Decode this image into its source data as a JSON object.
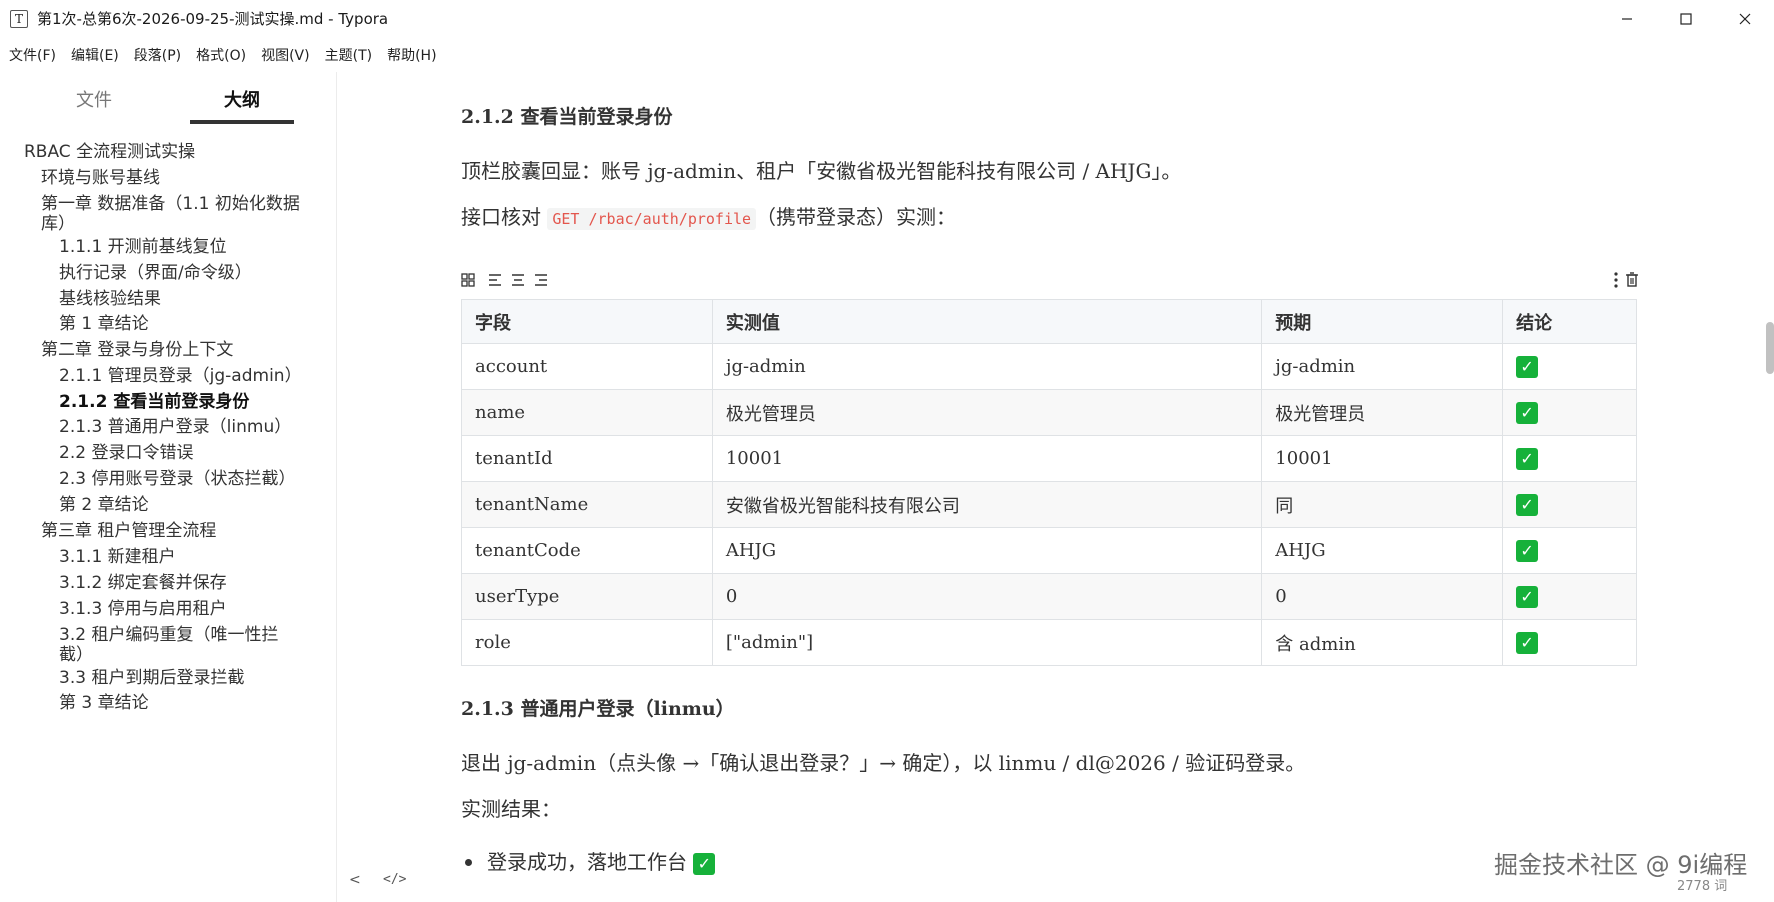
{
  "window": {
    "icon_glyph": "T",
    "title": "第1次-总第6次-2026-09-25-测试实操.md - Typora",
    "minimize_icon": "minimize-icon",
    "maximize_icon": "maximize-icon",
    "close_icon": "close-icon"
  },
  "menu": [
    "文件(F)",
    "编辑(E)",
    "段落(P)",
    "格式(O)",
    "视图(V)",
    "主题(T)",
    "帮助(H)"
  ],
  "sidebar": {
    "tabs": [
      "文件",
      "大纲"
    ],
    "active_tab": "大纲",
    "outline": [
      {
        "label": "RBAC 全流程测试实操",
        "level": 1
      },
      {
        "label": "环境与账号基线",
        "level": 2
      },
      {
        "label": "第一章 数据准备（1.1 初始化数据库）",
        "level": 2
      },
      {
        "label": "1.1.1 开测前基线复位",
        "level": 3
      },
      {
        "label": "执行记录（界面/命令级）",
        "level": 3
      },
      {
        "label": "基线核验结果",
        "level": 3
      },
      {
        "label": "第 1 章结论",
        "level": 3
      },
      {
        "label": "第二章 登录与身份上下文",
        "level": 2
      },
      {
        "label": "2.1.1 管理员登录（jg-admin）",
        "level": 3
      },
      {
        "label": "2.1.2 查看当前登录身份",
        "level": 3,
        "active": true
      },
      {
        "label": "2.1.3 普通用户登录（linmu）",
        "level": 3
      },
      {
        "label": "2.2 登录口令错误",
        "level": 3
      },
      {
        "label": "2.3 停用账号登录（状态拦截）",
        "level": 3
      },
      {
        "label": "第 2 章结论",
        "level": 3
      },
      {
        "label": "第三章 租户管理全流程",
        "level": 2
      },
      {
        "label": "3.1.1 新建租户",
        "level": 3
      },
      {
        "label": "3.1.2 绑定套餐并保存",
        "level": 3
      },
      {
        "label": "3.1.3 停用与启用租户",
        "level": 3
      },
      {
        "label": "3.2 租户编码重复（唯一性拦截）",
        "level": 3
      },
      {
        "label": "3.3 租户到期后登录拦截",
        "level": 3
      },
      {
        "label": "第 3 章结论",
        "level": 3
      }
    ],
    "footer": {
      "back_icon": "<",
      "source_icon": "</>"
    }
  },
  "doc": {
    "h_212": "2.1.2 查看当前登录身份",
    "p1": "顶栏胶囊回显：账号 jg-admin、租户「安徽省极光智能科技有限公司 / AHJG」。",
    "p2_prefix": "接口核对 ",
    "p2_code": "GET /rbac/auth/profile",
    "p2_suffix": "（携带登录态）实测：",
    "table_tools": {
      "grid_icon": "table-grid-icon",
      "align_left_icon": "align-left-icon",
      "align_center_icon": "align-center-icon",
      "align_right_icon": "align-right-icon",
      "more_icon": "more-vertical-icon",
      "delete_icon": "trash-icon"
    },
    "table": {
      "headers": [
        "字段",
        "实测值",
        "预期",
        "结论"
      ],
      "rows": [
        [
          "account",
          "jg-admin",
          "jg-admin",
          "✓"
        ],
        [
          "name",
          "极光管理员",
          "极光管理员",
          "✓"
        ],
        [
          "tenantId",
          "10001",
          "10001",
          "✓"
        ],
        [
          "tenantName",
          "安徽省极光智能科技有限公司",
          "同",
          "✓"
        ],
        [
          "tenantCode",
          "AHJG",
          "AHJG",
          "✓"
        ],
        [
          "userType",
          "0",
          "0",
          "✓"
        ],
        [
          "role",
          "[\"admin\"]",
          "含 admin",
          "✓"
        ]
      ]
    },
    "h_213": "2.1.3 普通用户登录（linmu）",
    "p3": "退出 jg-admin（点头像 →「确认退出登录？」→ 确定），以 linmu / dl@2026 / 验证码登录。",
    "p4": "实测结果：",
    "bullet1": "登录成功，落地工作台",
    "bullet1_check": "✓"
  },
  "watermark": "掘金技术社区 @ 9i编程",
  "word_count": "2778 词"
}
